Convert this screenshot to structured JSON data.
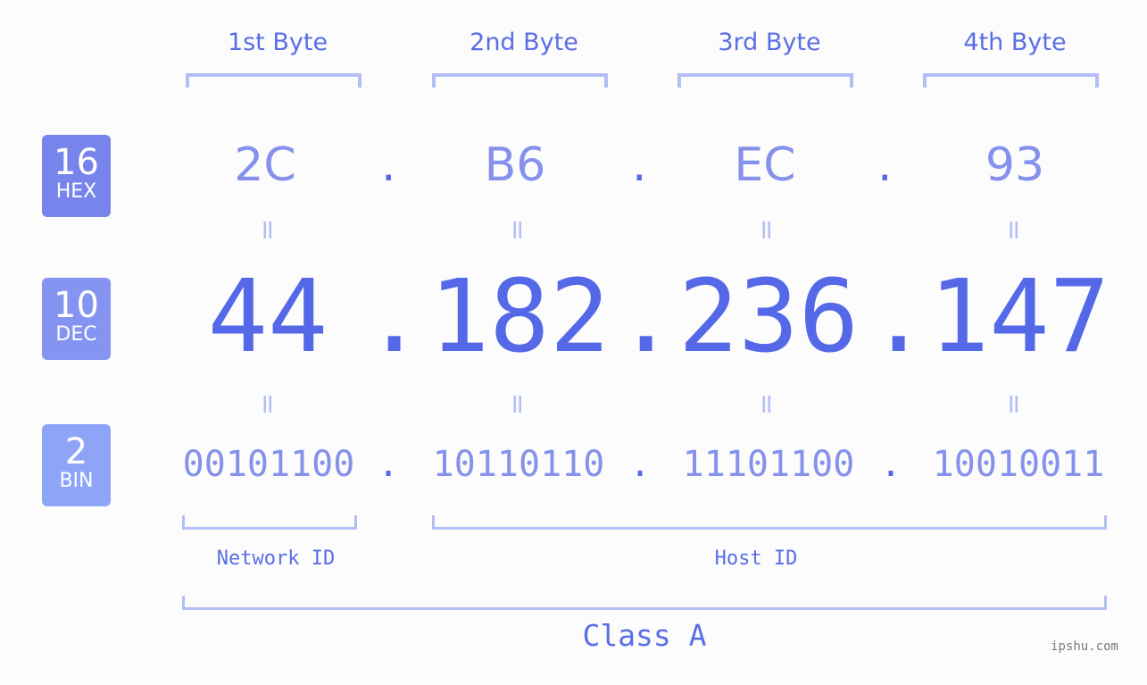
{
  "bytes": {
    "labels": [
      "1st Byte",
      "2nd Byte",
      "3rd Byte",
      "4th Byte"
    ]
  },
  "badges": {
    "hex": {
      "number": "16",
      "label": "HEX",
      "color": "#7684eb"
    },
    "dec": {
      "number": "10",
      "label": "DEC",
      "color": "#8594f0"
    },
    "bin": {
      "number": "2",
      "label": "BIN",
      "color": "#8ea5f7"
    }
  },
  "hex": [
    "2C",
    "B6",
    "EC",
    "93"
  ],
  "dec": [
    "44",
    "182",
    "236",
    "147"
  ],
  "bin": [
    "00101100",
    "10110110",
    "11101100",
    "10010011"
  ],
  "separator": ".",
  "equals": "=",
  "segments": {
    "network_id": "Network ID",
    "host_id": "Host ID",
    "ip_class": "Class A"
  },
  "watermark": "ipshu.com",
  "colors": {
    "primary": "#5468e8",
    "hex_text": "#8591ec",
    "bracket": "#b3bdf6",
    "background": "#fbfcfb"
  }
}
